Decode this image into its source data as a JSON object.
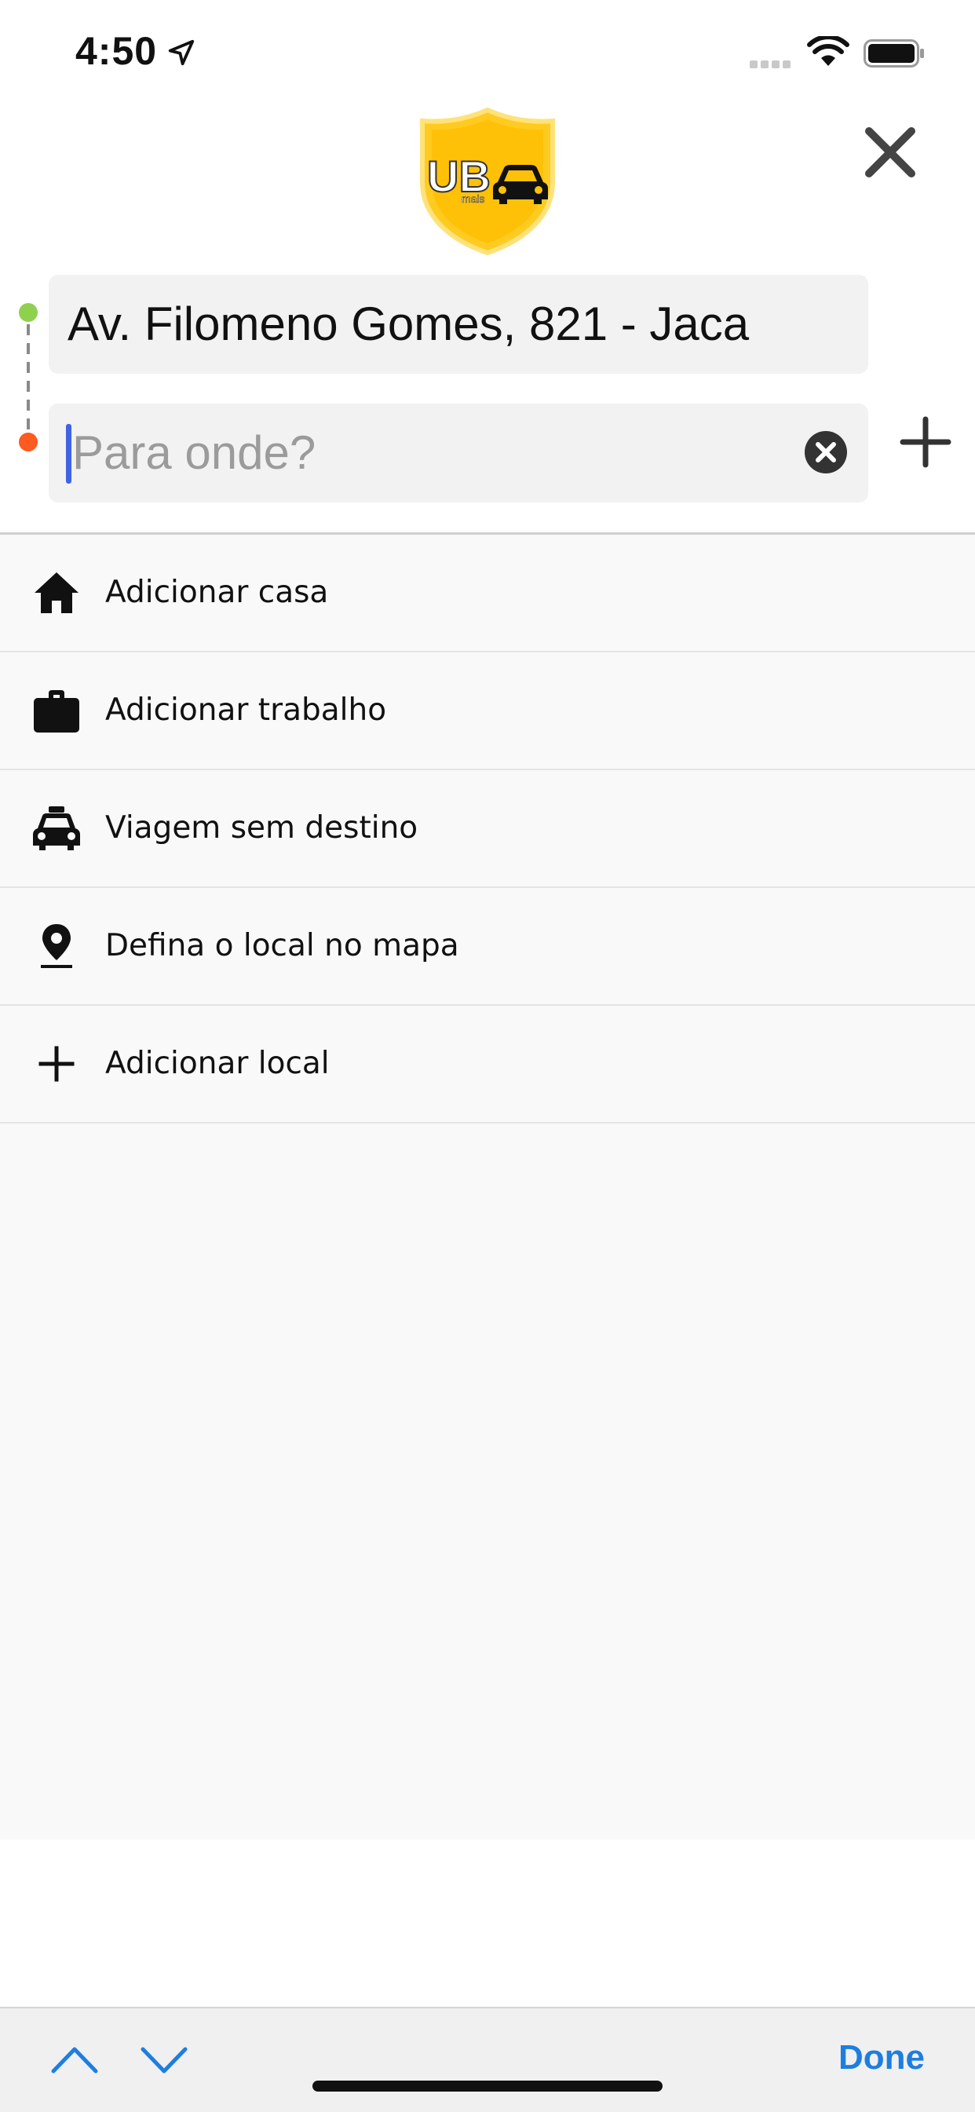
{
  "status_bar": {
    "time": "4:50"
  },
  "header": {
    "logo": {
      "letters": "UB",
      "sub": "mais"
    },
    "close_icon": "close-icon"
  },
  "route": {
    "origin": {
      "value": "Av. Filomeno Gomes, 821 - Jaca"
    },
    "destination": {
      "placeholder": "Para onde?",
      "value": ""
    },
    "origin_dot_color": "#8fd14f",
    "destination_dot_color": "#ff5a1f"
  },
  "options": [
    {
      "label": "Adicionar casa",
      "icon": "home-icon"
    },
    {
      "label": "Adicionar trabalho",
      "icon": "briefcase-icon"
    },
    {
      "label": "Viagem sem destino",
      "icon": "taxi-icon"
    },
    {
      "label": "Defina o local no mapa",
      "icon": "map-pin-icon"
    },
    {
      "label": "Adicionar local",
      "icon": "plus-icon"
    }
  ],
  "keyboard_bar": {
    "done_label": "Done"
  },
  "colors": {
    "accent": "#1e7ee0",
    "caret": "#3f63e6",
    "logo_yellow": "#ffcb21"
  }
}
